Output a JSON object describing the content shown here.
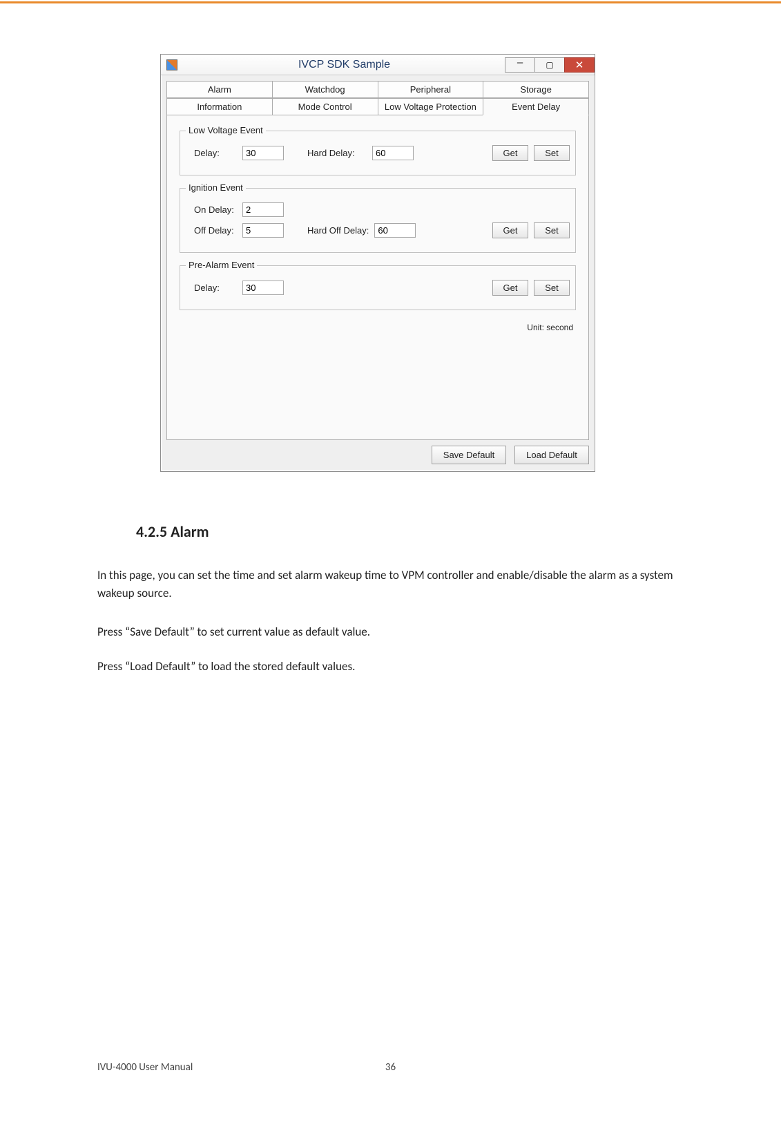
{
  "window": {
    "title": "IVCP SDK Sample",
    "tabs_row1": [
      "Alarm",
      "Watchdog",
      "Peripheral",
      "Storage"
    ],
    "tabs_row2": [
      "Information",
      "Mode Control",
      "Low Voltage Protection",
      "Event Delay"
    ],
    "active_tab": "Event Delay",
    "groups": {
      "low_voltage": {
        "title": "Low Voltage Event",
        "delay_label": "Delay:",
        "delay_value": "30",
        "hard_delay_label": "Hard Delay:",
        "hard_delay_value": "60",
        "get": "Get",
        "set": "Set"
      },
      "ignition": {
        "title": "Ignition Event",
        "on_delay_label": "On Delay:",
        "on_delay_value": "2",
        "off_delay_label": "Off Delay:",
        "off_delay_value": "5",
        "hard_off_label": "Hard Off Delay:",
        "hard_off_value": "60",
        "get": "Get",
        "set": "Set"
      },
      "prealarm": {
        "title": "Pre-Alarm Event",
        "delay_label": "Delay:",
        "delay_value": "30",
        "get": "Get",
        "set": "Set"
      }
    },
    "unit_note": "Unit: second",
    "save_default": "Save Default",
    "load_default": "Load Default"
  },
  "document": {
    "section_heading": "4.2.5 Alarm",
    "para1": "In this page, you can set the time and set alarm wakeup time to VPM controller and enable/disable the alarm as a system wakeup source.",
    "para2": "Press “Save Default” to set current value as default value.",
    "para3": "Press “Load Default” to load the stored default values.",
    "footer_left": "IVU-4000 User Manual",
    "page_number": "36"
  }
}
